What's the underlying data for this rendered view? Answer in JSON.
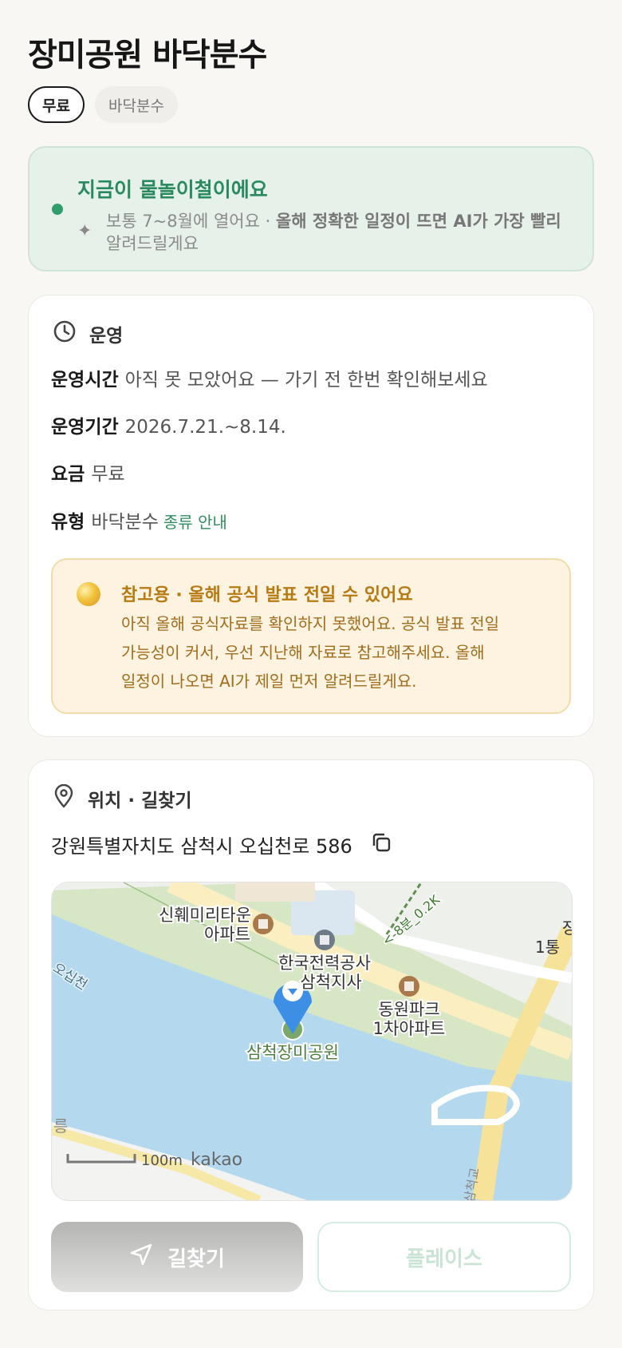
{
  "header": {
    "title": "장미공원 바닥분수",
    "tags": [
      "무료",
      "바닥분수"
    ]
  },
  "season_banner": {
    "headline": "지금이 물놀이철이에요",
    "note_prefix": "보통 7~8월에 열어요 · ",
    "note_bold": "올해 정확한 일정이 뜨면 AI가 가장 빨리",
    "note_suffix": "알려드릴게요",
    "sparkle_icon": "sparkle-icon",
    "status_color": "#2f9e6a"
  },
  "operation": {
    "section_title": "운영",
    "icon": "clock-icon",
    "hours": {
      "label": "운영시간",
      "value": "아직 못 모았어요 — 가기 전 한번 확인해보세요"
    },
    "period": {
      "label": "운영기간",
      "value": "2026.7.21.~8.14."
    },
    "fee": {
      "label": "요금",
      "value": "무료"
    },
    "type": {
      "label": "유형",
      "value": "바닥분수",
      "link": "종류 안내"
    },
    "notice": {
      "title": "참고용 · 올해 공식 발표 전일 수 있어요",
      "lines": [
        "아직 올해 공식자료를 확인하지 못했어요. 공식 발표 전일",
        "가능성이 커서, 우선 지난해 자료로 참고해주세요. 올해",
        "일정이 나오면 AI가 제일 먼저 알려드릴게요."
      ]
    }
  },
  "location": {
    "section_title": "위치 · 길찾기",
    "icon": "location-pin-icon",
    "address": "강원특별자치도 삼척시 오십천로 586",
    "copy_icon": "copy-icon",
    "map": {
      "labels": {
        "apt1_line1": "신훼미리타운",
        "apt1_line2": "아파트",
        "kepco_line1": "한국전력공사",
        "kepco_line2": "삼척지사",
        "apt2_line1": "동원파크",
        "apt2_line2": "1차아파트",
        "park": "삼척장미공원",
        "river": "오십천",
        "walk": "<-8분_0.2K",
        "edge_top_line1": "장",
        "edge_top_line2": "1통",
        "edge_left": "릉",
        "road_bottom": "삼척교",
        "scale": "100m",
        "brand": "kakao"
      }
    },
    "buttons": {
      "route": "길찾기",
      "place": "플레이스"
    }
  }
}
